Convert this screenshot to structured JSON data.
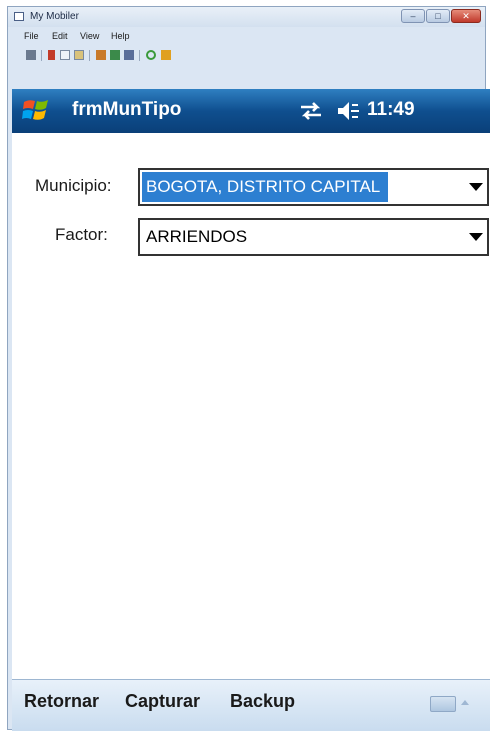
{
  "window": {
    "title": "My Mobiler",
    "menu": [
      "File",
      "Edit",
      "View",
      "Help"
    ]
  },
  "device": {
    "app_title": "frmMunTipo",
    "clock": "11:49"
  },
  "form": {
    "municipio_label": "Municipio:",
    "municipio_value": "BOGOTA, DISTRITO CAPITAL",
    "factor_label": "Factor:",
    "factor_value": "ARRIENDOS"
  },
  "softkeys": {
    "retornar": "Retornar",
    "capturar": "Capturar",
    "backup": "Backup"
  },
  "colors": {
    "taskbar": "#0f4f8f",
    "selection": "#2d7fd1",
    "softbar": "#c9dcef"
  }
}
